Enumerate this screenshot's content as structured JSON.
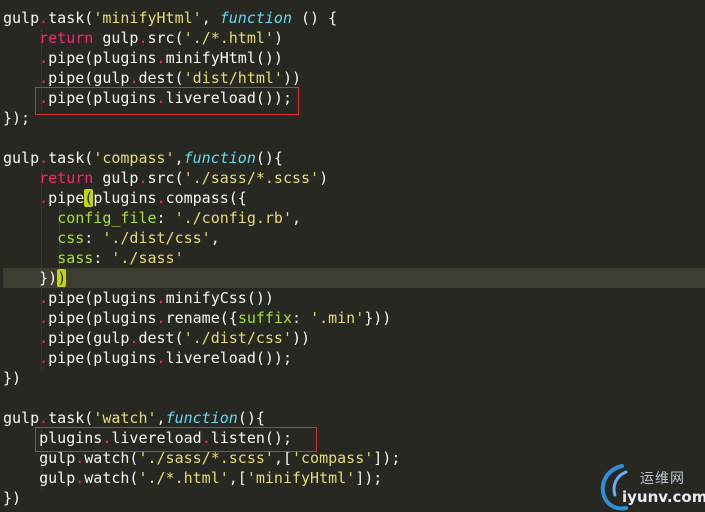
{
  "editor": {
    "theme_colors": {
      "background": "#272822",
      "current_line": "#3e3d32",
      "keyword": "#f92672",
      "string": "#e6db74",
      "function_keyword": "#66d9ef",
      "property": "#a6e22e",
      "selection_box": "#d83030"
    },
    "lines": [
      {
        "tokens": [
          {
            "t": "gulp",
            "c": "plain"
          },
          {
            "t": ".",
            "c": "dot"
          },
          {
            "t": "task(",
            "c": "plain"
          },
          {
            "t": "'minifyHtml'",
            "c": "string"
          },
          {
            "t": ", ",
            "c": "plain"
          },
          {
            "t": "function",
            "c": "function"
          },
          {
            "t": " () {",
            "c": "plain"
          }
        ]
      },
      {
        "tokens": [
          {
            "t": "    ",
            "c": "plain"
          },
          {
            "t": "return",
            "c": "keyword"
          },
          {
            "t": " gulp",
            "c": "plain"
          },
          {
            "t": ".",
            "c": "dot"
          },
          {
            "t": "src(",
            "c": "plain"
          },
          {
            "t": "'./*.html'",
            "c": "string"
          },
          {
            "t": ")",
            "c": "plain"
          }
        ]
      },
      {
        "tokens": [
          {
            "t": "    ",
            "c": "plain"
          },
          {
            "t": ".",
            "c": "dot"
          },
          {
            "t": "pipe(plugins",
            "c": "plain"
          },
          {
            "t": ".",
            "c": "dot"
          },
          {
            "t": "minifyHtml())",
            "c": "plain"
          }
        ]
      },
      {
        "tokens": [
          {
            "t": "    ",
            "c": "plain"
          },
          {
            "t": ".",
            "c": "dot"
          },
          {
            "t": "pipe(gulp",
            "c": "plain"
          },
          {
            "t": ".",
            "c": "dot"
          },
          {
            "t": "dest(",
            "c": "plain"
          },
          {
            "t": "'dist/html'",
            "c": "string"
          },
          {
            "t": "))",
            "c": "plain"
          }
        ]
      },
      {
        "tokens": [
          {
            "t": "    ",
            "c": "plain"
          },
          {
            "t": ".",
            "c": "dot"
          },
          {
            "t": "pipe(plugins",
            "c": "plain"
          },
          {
            "t": ".",
            "c": "dot"
          },
          {
            "t": "livereload());",
            "c": "plain"
          }
        ]
      },
      {
        "tokens": [
          {
            "t": "});",
            "c": "plain"
          }
        ]
      },
      {
        "tokens": []
      },
      {
        "tokens": [
          {
            "t": "gulp",
            "c": "plain"
          },
          {
            "t": ".",
            "c": "dot"
          },
          {
            "t": "task(",
            "c": "plain"
          },
          {
            "t": "'compass'",
            "c": "string"
          },
          {
            "t": ",",
            "c": "plain"
          },
          {
            "t": "function",
            "c": "function"
          },
          {
            "t": "(){",
            "c": "plain"
          }
        ]
      },
      {
        "tokens": [
          {
            "t": "    ",
            "c": "plain"
          },
          {
            "t": "return",
            "c": "keyword"
          },
          {
            "t": " gulp",
            "c": "plain"
          },
          {
            "t": ".",
            "c": "dot"
          },
          {
            "t": "src(",
            "c": "plain"
          },
          {
            "t": "'./sass/*.scss'",
            "c": "string"
          },
          {
            "t": ")",
            "c": "plain"
          }
        ]
      },
      {
        "tokens": [
          {
            "t": "    ",
            "c": "plain"
          },
          {
            "t": ".",
            "c": "dot"
          },
          {
            "t": "pipe",
            "c": "plain"
          },
          {
            "t": "(",
            "c": "paren_match"
          },
          {
            "t": "plugins",
            "c": "plain"
          },
          {
            "t": ".",
            "c": "dot"
          },
          {
            "t": "compass({",
            "c": "plain"
          }
        ]
      },
      {
        "tokens": [
          {
            "t": "      ",
            "c": "plain"
          },
          {
            "t": "config_file",
            "c": "prop"
          },
          {
            "t": ": ",
            "c": "plain"
          },
          {
            "t": "'./config.rb'",
            "c": "string"
          },
          {
            "t": ",",
            "c": "plain"
          }
        ]
      },
      {
        "tokens": [
          {
            "t": "      ",
            "c": "plain"
          },
          {
            "t": "css",
            "c": "prop"
          },
          {
            "t": ": ",
            "c": "plain"
          },
          {
            "t": "'./dist/css'",
            "c": "string"
          },
          {
            "t": ",",
            "c": "plain"
          }
        ]
      },
      {
        "tokens": [
          {
            "t": "      ",
            "c": "plain"
          },
          {
            "t": "sass",
            "c": "prop"
          },
          {
            "t": ": ",
            "c": "plain"
          },
          {
            "t": "'./sass'",
            "c": "string"
          }
        ]
      },
      {
        "tokens": [
          {
            "t": "    })",
            "c": "plain"
          },
          {
            "t": ")",
            "c": "paren_match"
          }
        ],
        "current": true
      },
      {
        "tokens": [
          {
            "t": "    ",
            "c": "plain"
          },
          {
            "t": ".",
            "c": "dot"
          },
          {
            "t": "pipe(plugins",
            "c": "plain"
          },
          {
            "t": ".",
            "c": "dot"
          },
          {
            "t": "minifyCss())",
            "c": "plain"
          }
        ]
      },
      {
        "tokens": [
          {
            "t": "    ",
            "c": "plain"
          },
          {
            "t": ".",
            "c": "dot"
          },
          {
            "t": "pipe(plugins",
            "c": "plain"
          },
          {
            "t": ".",
            "c": "dot"
          },
          {
            "t": "rename({",
            "c": "plain"
          },
          {
            "t": "suffix",
            "c": "prop"
          },
          {
            "t": ": ",
            "c": "plain"
          },
          {
            "t": "'.min'",
            "c": "string"
          },
          {
            "t": "}))",
            "c": "plain"
          }
        ]
      },
      {
        "tokens": [
          {
            "t": "    ",
            "c": "plain"
          },
          {
            "t": ".",
            "c": "dot"
          },
          {
            "t": "pipe(gulp",
            "c": "plain"
          },
          {
            "t": ".",
            "c": "dot"
          },
          {
            "t": "dest(",
            "c": "plain"
          },
          {
            "t": "'./dist/css'",
            "c": "string"
          },
          {
            "t": "))",
            "c": "plain"
          }
        ]
      },
      {
        "tokens": [
          {
            "t": "    ",
            "c": "plain"
          },
          {
            "t": ".",
            "c": "dot"
          },
          {
            "t": "pipe(plugins",
            "c": "plain"
          },
          {
            "t": ".",
            "c": "dot"
          },
          {
            "t": "livereload());",
            "c": "plain"
          }
        ]
      },
      {
        "tokens": [
          {
            "t": "})",
            "c": "plain"
          }
        ]
      },
      {
        "tokens": []
      },
      {
        "tokens": [
          {
            "t": "gulp",
            "c": "plain"
          },
          {
            "t": ".",
            "c": "dot"
          },
          {
            "t": "task(",
            "c": "plain"
          },
          {
            "t": "'watch'",
            "c": "string"
          },
          {
            "t": ",",
            "c": "plain"
          },
          {
            "t": "function",
            "c": "function"
          },
          {
            "t": "(){",
            "c": "plain"
          }
        ]
      },
      {
        "tokens": [
          {
            "t": "    plugins",
            "c": "plain"
          },
          {
            "t": ".",
            "c": "dot"
          },
          {
            "t": "livereload",
            "c": "plain"
          },
          {
            "t": ".",
            "c": "dot"
          },
          {
            "t": "listen();",
            "c": "plain"
          }
        ]
      },
      {
        "tokens": [
          {
            "t": "    gulp",
            "c": "plain"
          },
          {
            "t": ".",
            "c": "dot"
          },
          {
            "t": "watch(",
            "c": "plain"
          },
          {
            "t": "'./sass/*.scss'",
            "c": "string"
          },
          {
            "t": ",[",
            "c": "plain"
          },
          {
            "t": "'compass'",
            "c": "string"
          },
          {
            "t": "]);",
            "c": "plain"
          }
        ]
      },
      {
        "tokens": [
          {
            "t": "    gulp",
            "c": "plain"
          },
          {
            "t": ".",
            "c": "dot"
          },
          {
            "t": "watch(",
            "c": "plain"
          },
          {
            "t": "'./*.html'",
            "c": "string"
          },
          {
            "t": ",[",
            "c": "plain"
          },
          {
            "t": "'minifyHtml'",
            "c": "string"
          },
          {
            "t": "]);",
            "c": "plain"
          }
        ]
      },
      {
        "tokens": [
          {
            "t": "})",
            "c": "plain"
          }
        ]
      }
    ]
  },
  "watermark": {
    "cn_text": "运维网",
    "en_text": "iyunv.com"
  }
}
